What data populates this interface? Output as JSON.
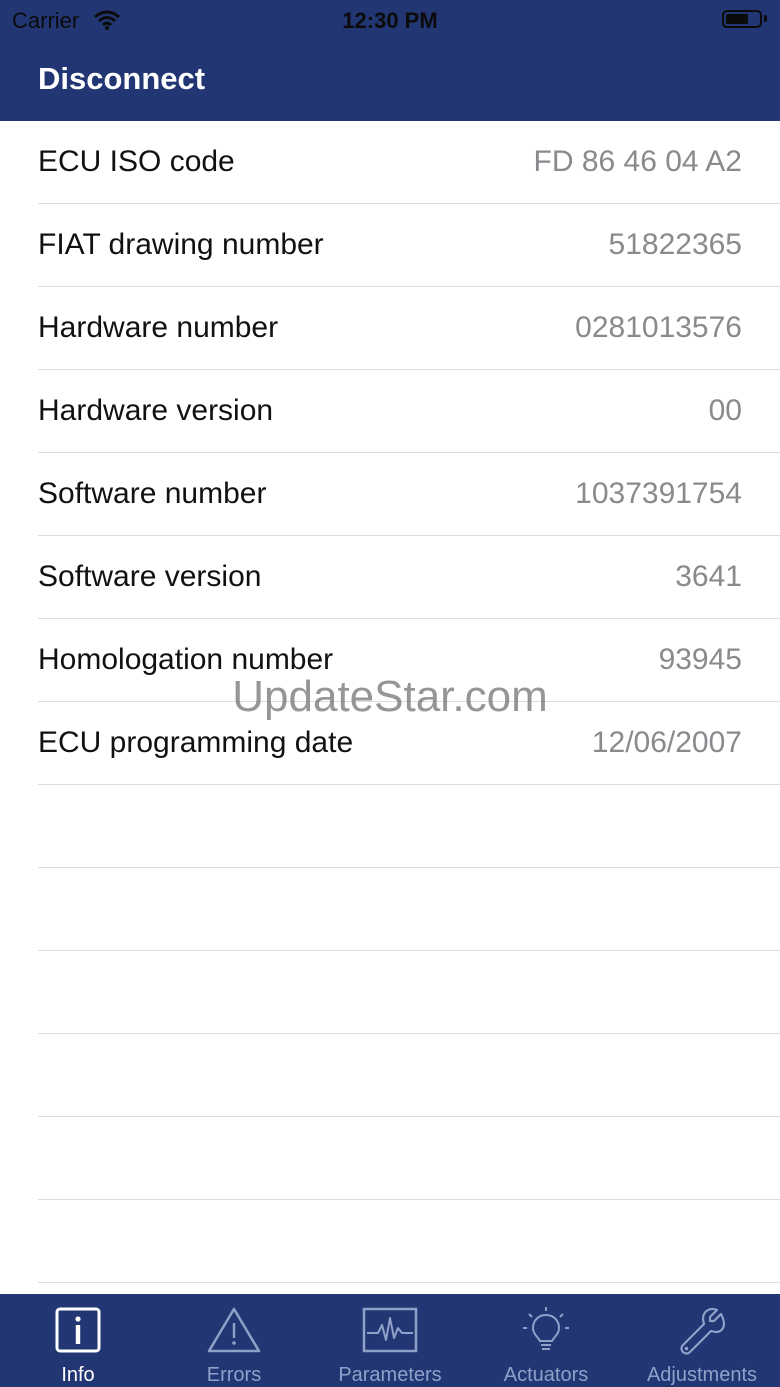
{
  "status_bar": {
    "carrier": "Carrier",
    "time": "12:30 PM"
  },
  "nav": {
    "title": "Disconnect"
  },
  "rows": [
    {
      "label": "ECU ISO code",
      "value": "FD 86 46 04 A2"
    },
    {
      "label": "FIAT drawing number",
      "value": "51822365"
    },
    {
      "label": "Hardware number",
      "value": "0281013576"
    },
    {
      "label": "Hardware version",
      "value": "00"
    },
    {
      "label": "Software number",
      "value": "1037391754"
    },
    {
      "label": "Software version",
      "value": "3641"
    },
    {
      "label": "Homologation number",
      "value": "93945"
    },
    {
      "label": "ECU programming date",
      "value": "12/06/2007"
    }
  ],
  "watermark": "UpdateStar.com",
  "tabs": [
    {
      "label": "Info",
      "icon": "info-icon",
      "active": true
    },
    {
      "label": "Errors",
      "icon": "warning-icon",
      "active": false
    },
    {
      "label": "Parameters",
      "icon": "waveform-icon",
      "active": false
    },
    {
      "label": "Actuators",
      "icon": "lightbulb-icon",
      "active": false
    },
    {
      "label": "Adjustments",
      "icon": "wrench-icon",
      "active": false
    }
  ],
  "colors": {
    "bar": "#223673",
    "tab_inactive": "#8fa0c9",
    "value_text": "#8a8a8e"
  }
}
